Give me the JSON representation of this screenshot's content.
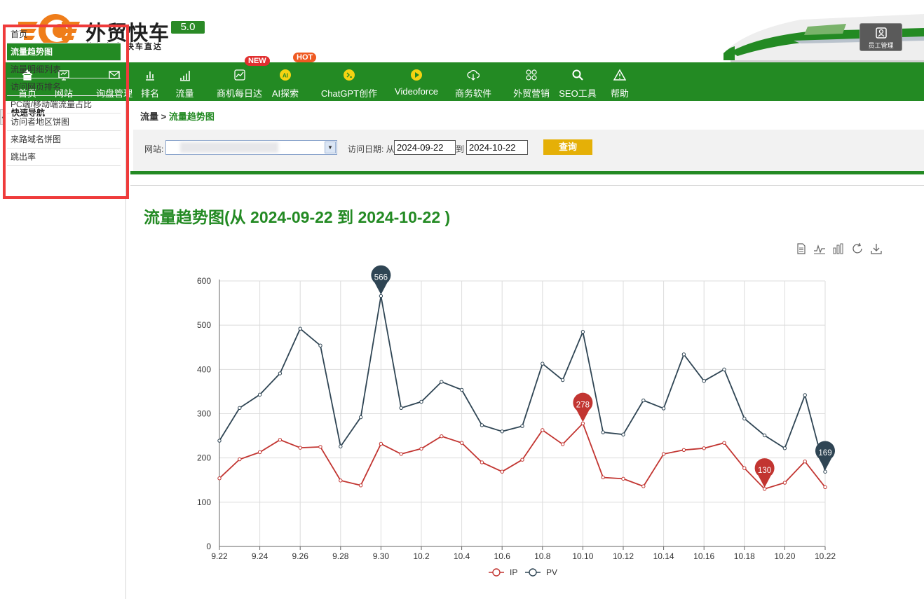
{
  "header": {
    "brand": "外贸快车",
    "tagline": "外贸全球 快车直达",
    "version": "5.0",
    "employee_button": "员工管理"
  },
  "nav": {
    "items": [
      {
        "label": "首页",
        "icon": "home-icon"
      },
      {
        "label": "网站",
        "icon": "monitor-icon"
      },
      {
        "label": "询盘管理",
        "icon": "mail-icon"
      },
      {
        "label": "排名",
        "icon": "ranking-icon"
      },
      {
        "label": "流量",
        "icon": "bar-signal-icon"
      },
      {
        "label": "商机每日达",
        "icon": "trend-icon"
      },
      {
        "label": "AI探索",
        "icon": "ai-icon"
      },
      {
        "label": "ChatGPT创作",
        "icon": "chatgpt-icon"
      },
      {
        "label": "Videoforce",
        "icon": "video-icon"
      },
      {
        "label": "商务软件",
        "icon": "cloud-download-icon"
      },
      {
        "label": "外贸营销",
        "icon": "grid-icon"
      },
      {
        "label": "SEO工具",
        "icon": "search-icon"
      },
      {
        "label": "帮助",
        "icon": "warning-icon"
      }
    ],
    "badge_new": "NEW",
    "badge_hot": "HOT"
  },
  "sidebar": {
    "title": "快速导航",
    "collapse": "‹",
    "items": [
      {
        "label": "首页"
      },
      {
        "label": "流量趋势图"
      },
      {
        "label": "流量明细列表"
      },
      {
        "label": "访问网页排名"
      },
      {
        "label": "PC端/移动端流量占比"
      },
      {
        "label": "访问者地区饼图"
      },
      {
        "label": "来路域名饼图"
      },
      {
        "label": "跳出率"
      }
    ],
    "active_index": 1
  },
  "breadcrumb": {
    "parent": "流量",
    "separator": " > ",
    "current": "流量趋势图"
  },
  "filter": {
    "site_label": "网站:",
    "date_label": "访问日期: 从",
    "from": "2024-09-22",
    "to_label": "到",
    "to": "2024-10-22",
    "query_button": "查询"
  },
  "chart_title": "流量趋势图(从 2024-09-22 到 2024-10-22 )",
  "colors": {
    "brand_green": "#238a23",
    "ip": "#c23531",
    "pv": "#2f4554",
    "query": "#e5b007",
    "highlight": "#ef3b3b"
  },
  "chart_data": {
    "type": "line",
    "title": "",
    "xlabel": "",
    "ylabel": "",
    "ylim": [
      0,
      600
    ],
    "yticks": [
      0,
      100,
      200,
      300,
      400,
      500,
      600
    ],
    "grid": true,
    "legend": "bottom-center",
    "x": [
      "9.22",
      "9.23",
      "9.24",
      "9.25",
      "9.26",
      "9.27",
      "9.28",
      "9.29",
      "9.30",
      "10.1",
      "10.2",
      "10.3",
      "10.4",
      "10.5",
      "10.6",
      "10.7",
      "10.8",
      "10.9",
      "10.10",
      "10.11",
      "10.12",
      "10.13",
      "10.14",
      "10.15",
      "10.16",
      "10.17",
      "10.18",
      "10.19",
      "10.20",
      "10.21",
      "10.22"
    ],
    "x_tick_labels": [
      "9.22",
      "9.24",
      "9.26",
      "9.28",
      "9.30",
      "10.2",
      "10.4",
      "10.6",
      "10.8",
      "10.10",
      "10.12",
      "10.14",
      "10.16",
      "10.18",
      "10.20",
      "10.22"
    ],
    "series": [
      {
        "name": "IP",
        "values": [
          154,
          197,
          213,
          241,
          223,
          225,
          149,
          138,
          232,
          209,
          221,
          249,
          234,
          190,
          169,
          196,
          263,
          231,
          278,
          156,
          153,
          136,
          209,
          218,
          222,
          234,
          177,
          130,
          144,
          192,
          134
        ],
        "markers": [
          {
            "label": "278",
            "index": 18
          },
          {
            "label": "130",
            "index": 27
          }
        ]
      },
      {
        "name": "PV",
        "values": [
          239,
          313,
          343,
          391,
          492,
          454,
          226,
          292,
          566,
          313,
          327,
          372,
          354,
          274,
          260,
          272,
          413,
          376,
          485,
          258,
          253,
          330,
          312,
          434,
          374,
          400,
          289,
          251,
          222,
          342,
          169
        ],
        "markers": [
          {
            "label": "566",
            "index": 8
          },
          {
            "label": "169",
            "index": 30
          }
        ]
      }
    ],
    "toolbox": [
      "data-view-icon",
      "line-switch-icon",
      "bar-switch-icon",
      "restore-icon",
      "save-image-icon"
    ]
  }
}
